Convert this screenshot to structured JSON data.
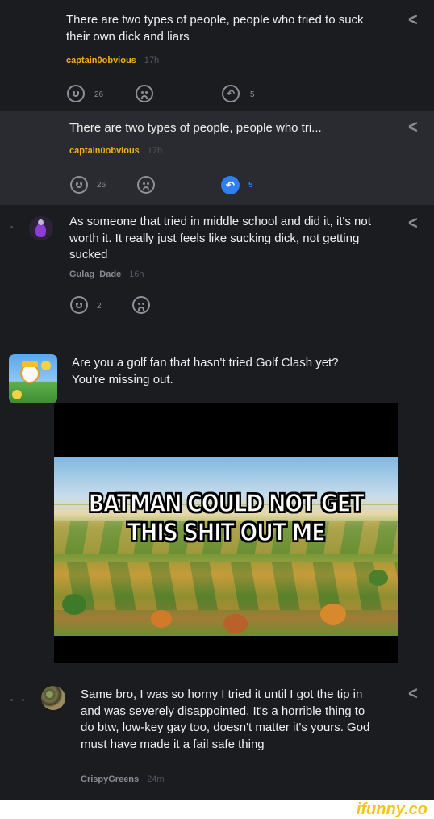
{
  "comments": [
    {
      "text": "There are two types of people, people who tried to suck their own dick and liars",
      "user": "captain0obvious",
      "time": "17h",
      "smile_count": "26",
      "reply_count": "5"
    },
    {
      "text": "There are two types of people, people who tri...",
      "user": "captain0obvious",
      "time": "17h",
      "smile_count": "26",
      "reply_count": "5"
    },
    {
      "text": "As someone that tried in middle school and did it, it's not worth it. It really just feels like sucking dick, not getting sucked",
      "user": "Gulag_Dade",
      "time": "16h",
      "smile_count": "2"
    },
    {
      "text": "Same bro, I was so horny I tried it until I got the tip in and was severely disappointed. It's a horrible thing to do btw, low-key gay too, doesn't matter it's yours. God must have made it a fail safe thing",
      "user": "CrispyGreens",
      "time": "24m"
    }
  ],
  "ad": {
    "text": "Are you a golf fan that hasn't tried Golf Clash yet? You're missing out."
  },
  "meme": {
    "line1": "BATMAN COULD NOT GET",
    "line2": "THIS SHIT OUT ME"
  },
  "watermark": "ifunny.co",
  "colors": {
    "username": "#f2b019",
    "selected_bg": "#2a2b30",
    "reply_active": "#2f7ff0",
    "watermark": "#f6c419"
  }
}
